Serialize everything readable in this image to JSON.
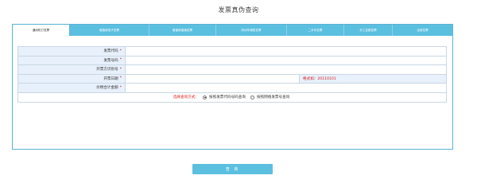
{
  "page": {
    "title": "发票真伪查询"
  },
  "tabs": [
    {
      "label": "通用机打发票",
      "active": true
    },
    {
      "label": "增值税电子发票",
      "active": false
    },
    {
      "label": "增值税普通发票",
      "active": false
    },
    {
      "label": "机动车销售发票",
      "active": false
    },
    {
      "label": "二手车发票",
      "active": false
    },
    {
      "label": "手工定额发票",
      "active": false
    },
    {
      "label": "全部发票",
      "active": false
    }
  ],
  "form": {
    "fields": [
      {
        "label": "发票代码",
        "required": "*",
        "value": ""
      },
      {
        "label": "发票号码",
        "required": "*",
        "value": ""
      },
      {
        "label": "开票方识别号",
        "required": "*",
        "value": ""
      },
      {
        "label": "开票日期",
        "required": "*",
        "value": "",
        "hint": "格式如：20110101"
      },
      {
        "label": "价税合计金额",
        "required": "*",
        "value": ""
      }
    ],
    "method": {
      "label": "选择查询方式：",
      "options": [
        {
          "label": "按照发票代码号码查询",
          "selected": true
        },
        {
          "label": "按照网络发票号查询",
          "selected": false
        }
      ]
    }
  },
  "query_button": {
    "label": "查 询"
  },
  "colors": {
    "accent": "#5bbfe0",
    "label_bg": "#e7f0fb",
    "warning": "#e02020"
  }
}
